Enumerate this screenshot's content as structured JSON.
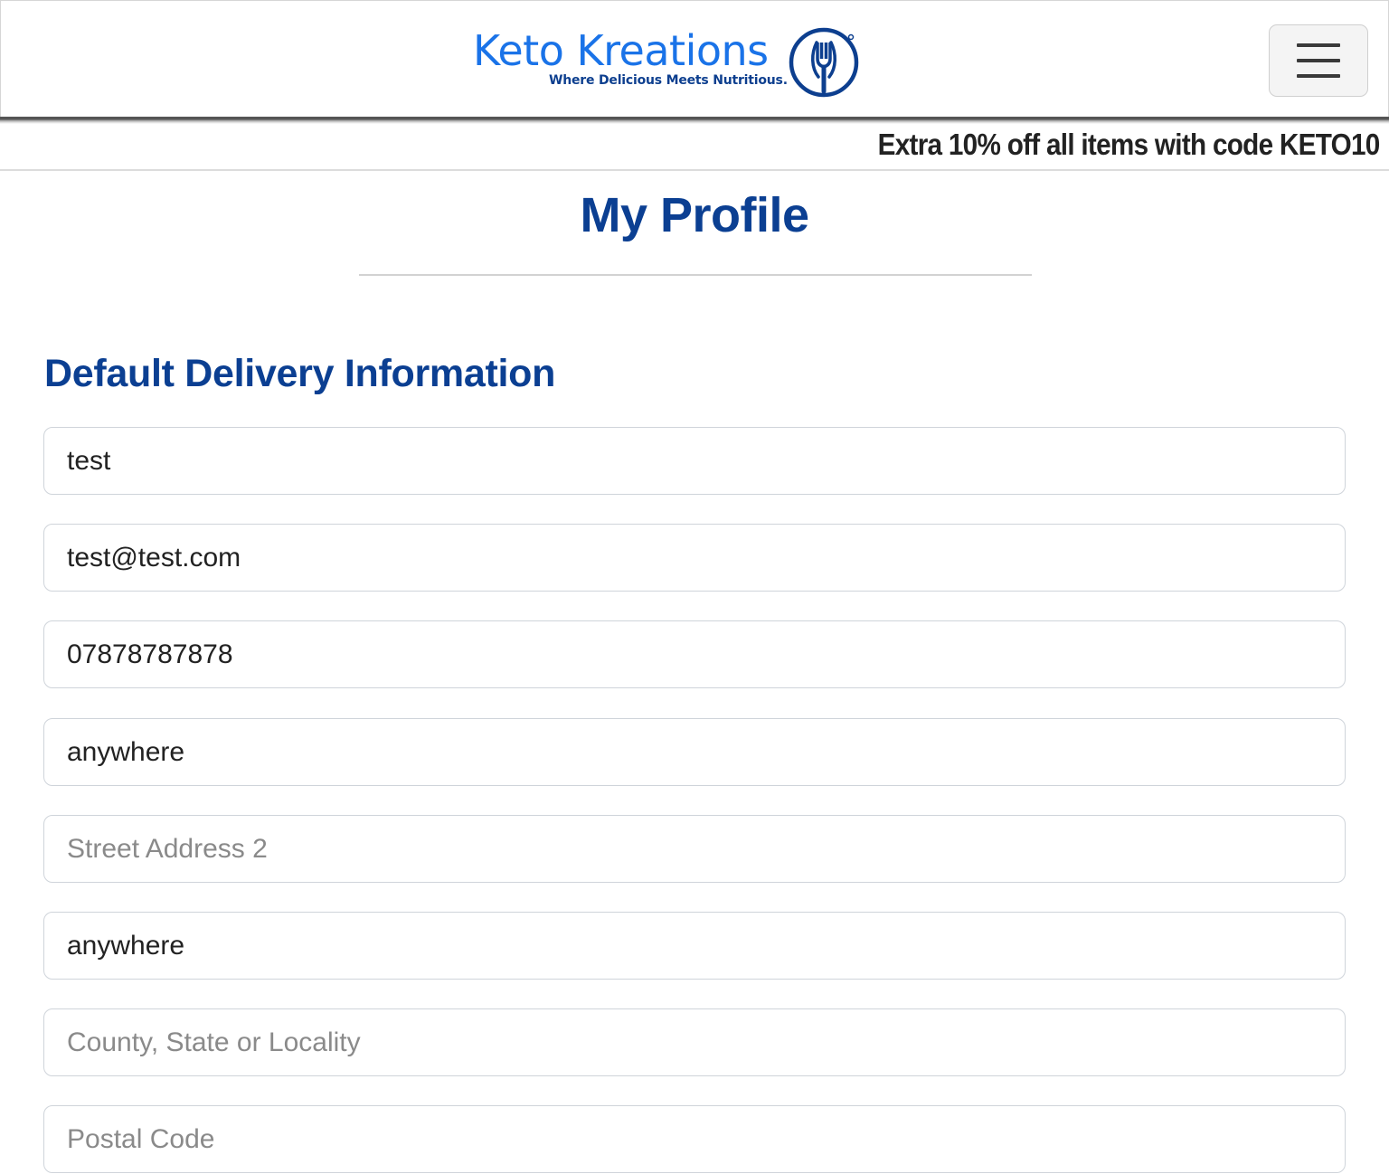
{
  "header": {
    "logo": {
      "name": "Keto Kreations",
      "tagline": "Where Delicious Meets Nutritious."
    },
    "menu_icon": "hamburger-menu-icon"
  },
  "promo": {
    "text": "Extra 10% off all items with code KETO10"
  },
  "main": {
    "page_title": "My Profile",
    "section_title": "Default Delivery Information",
    "fields": [
      {
        "name": "full-name-field",
        "value": "test",
        "placeholder": ""
      },
      {
        "name": "email-field",
        "value": "test@test.com",
        "placeholder": ""
      },
      {
        "name": "phone-number-field",
        "value": "07878787878",
        "placeholder": ""
      },
      {
        "name": "street-address-1-field",
        "value": "anywhere",
        "placeholder": ""
      },
      {
        "name": "street-address-2-field",
        "value": "",
        "placeholder": "Street Address 2"
      },
      {
        "name": "town-city-field",
        "value": "anywhere",
        "placeholder": ""
      },
      {
        "name": "county-field",
        "value": "",
        "placeholder": "County, State or Locality"
      },
      {
        "name": "postal-code-field",
        "value": "",
        "placeholder": "Postal Code"
      }
    ]
  },
  "colors": {
    "brand_blue": "#1a73e8",
    "heading_blue": "#0b3f92",
    "tagline_navy": "#0d3f8f"
  }
}
